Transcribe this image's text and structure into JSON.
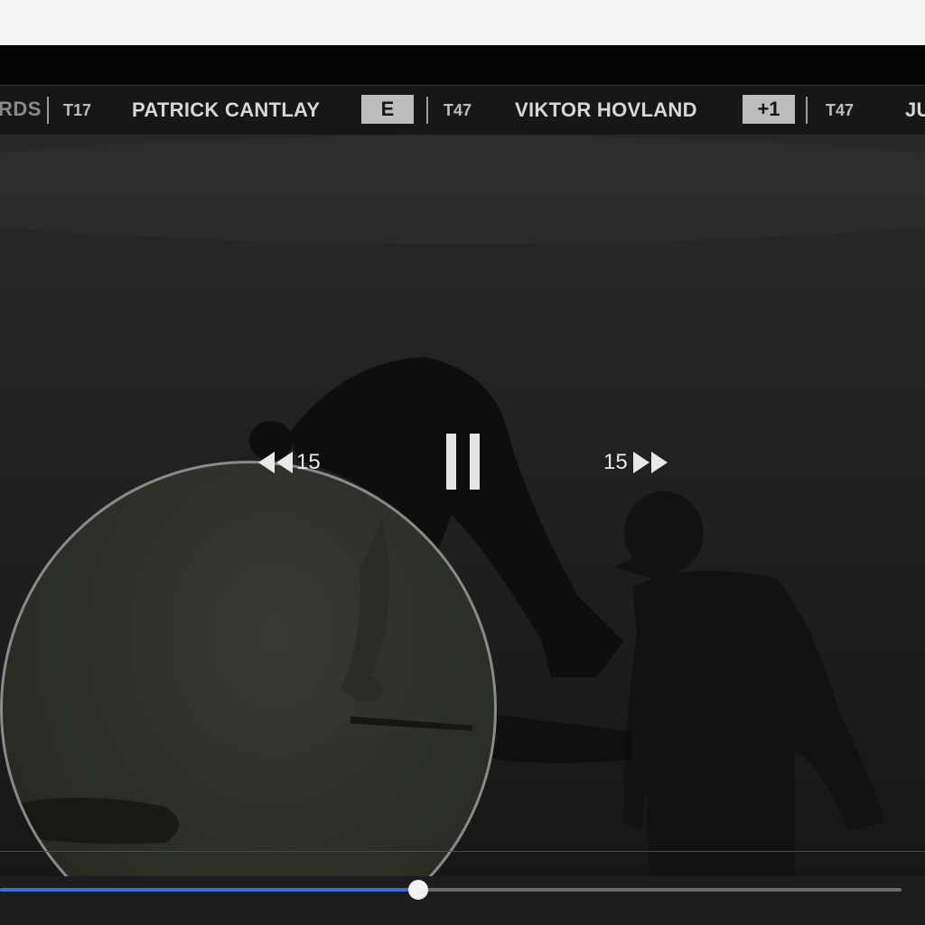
{
  "ticker": {
    "lead_fragment": "RDS",
    "entries": [
      {
        "position": "T17",
        "name": "PATRICK CANTLAY",
        "score": "E"
      },
      {
        "position": "T47",
        "name": "VIKTOR HOVLAND",
        "score": "+1"
      },
      {
        "position": "T47",
        "name": "JU"
      }
    ]
  },
  "controls": {
    "rewind_seconds": "15",
    "forward_seconds": "15"
  },
  "playback": {
    "progress": 0.464
  },
  "colors": {
    "progress_fill": "#3a6ed8",
    "ticker_bg": "#161616",
    "score_badge": "#bdbdbd"
  },
  "icons": {
    "rewind": "double-chevron-left-icon",
    "forward": "double-chevron-right-icon",
    "pause": "pause-icon"
  }
}
